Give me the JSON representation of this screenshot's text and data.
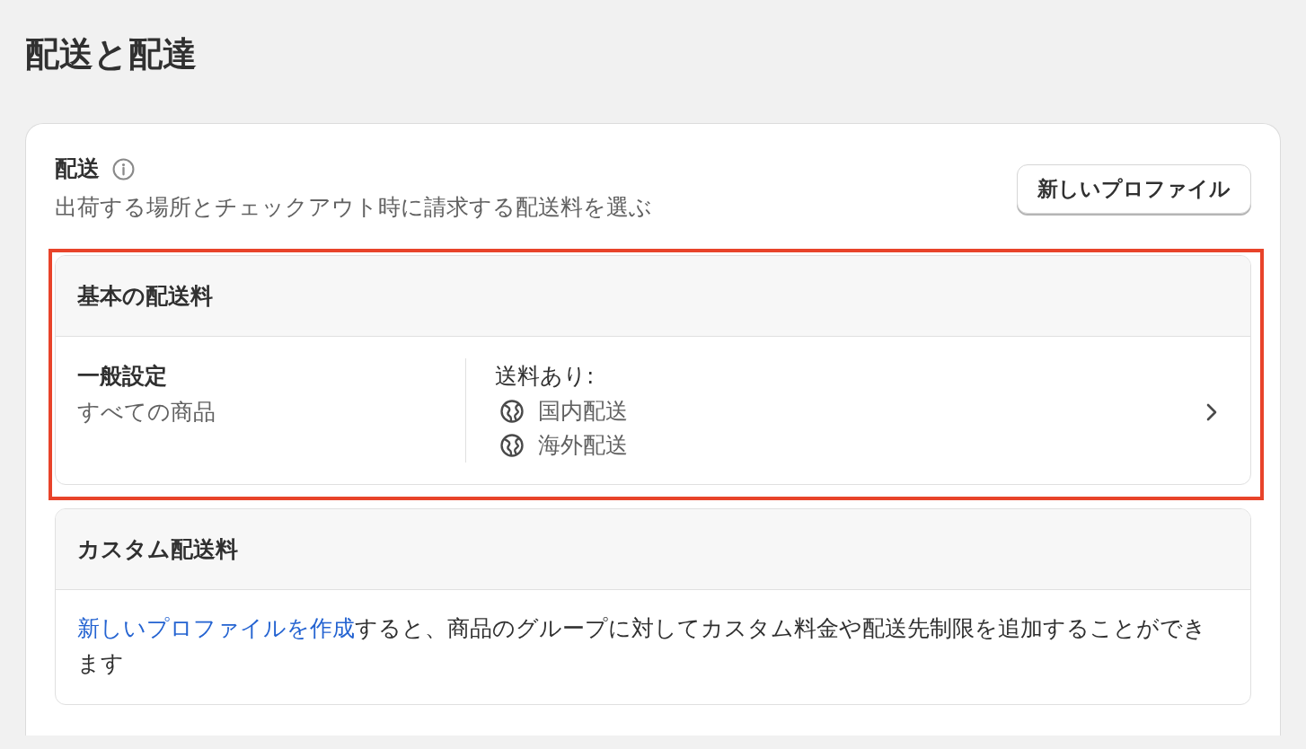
{
  "page": {
    "title": "配送と配達"
  },
  "shipping_card": {
    "title": "配送",
    "subtitle": "出荷する場所とチェックアウト時に請求する配送料を選ぶ",
    "button": "新しいプロファイル",
    "sections": [
      {
        "kind": "profile",
        "title": "基本の配送料",
        "highlighted": true,
        "profile_name": "一般設定",
        "profile_scope": "すべての商品",
        "rates_label": "送料あり:",
        "zones": [
          "国内配送",
          "海外配送"
        ]
      },
      {
        "kind": "notice",
        "title": "カスタム配送料",
        "highlighted": false,
        "link": "新しいプロファイルを作成",
        "text": "すると、商品のグループに対してカスタム料金や配送先制限を追加することができます"
      }
    ]
  }
}
